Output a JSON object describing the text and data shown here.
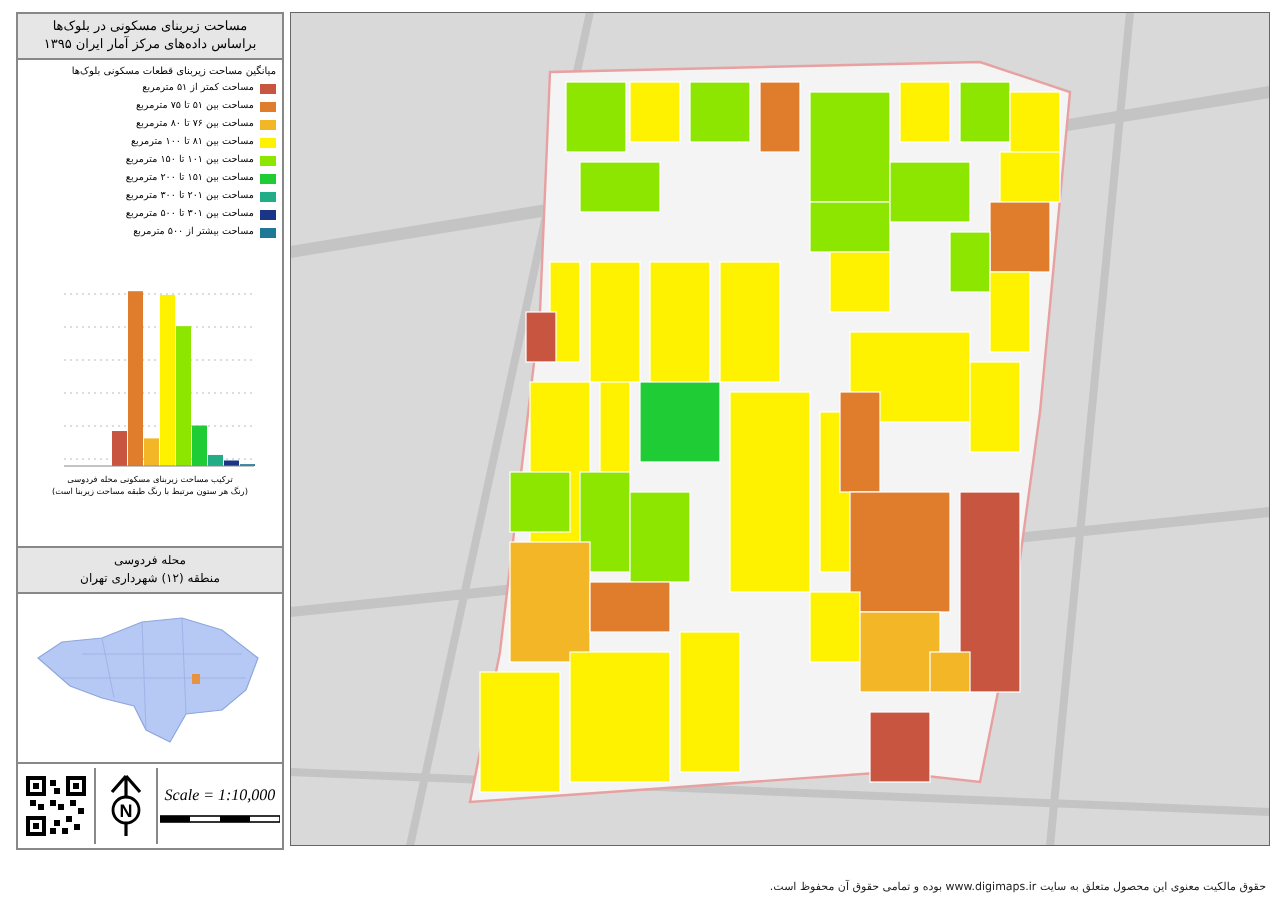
{
  "panel": {
    "title": "مساحت زیربنای مسکونی در بلوک‌ها",
    "subtitle": "براساس داده‌های مرکز آمار ایران ۱۳۹۵",
    "legend_heading": "میانگین مساحت زیربنای قطعات مسکونی بلوک‌ها",
    "legend": [
      {
        "label": "مساحت کمتر از ۵۱ مترمربع",
        "color": "#c8553f"
      },
      {
        "label": "مساحت بین ۵۱ تا ۷۵ مترمربع",
        "color": "#e07d2c"
      },
      {
        "label": "مساحت بین ۷۶ تا ۸۰ مترمربع",
        "color": "#f2b626"
      },
      {
        "label": "مساحت بین ۸۱ تا ۱۰۰ مترمربع",
        "color": "#fff200"
      },
      {
        "label": "مساحت بین ۱۰۱ تا ۱۵۰ مترمربع",
        "color": "#8de600"
      },
      {
        "label": "مساحت بین ۱۵۱ تا ۲۰۰ مترمربع",
        "color": "#1fcc35"
      },
      {
        "label": "مساحت بین ۲۰۱ تا ۳۰۰ مترمربع",
        "color": "#22ad86"
      },
      {
        "label": "مساحت بین ۳۰۱ تا ۵۰۰ مترمربع",
        "color": "#1a3585"
      },
      {
        "label": "مساحت بیشتر از ۵۰۰ مترمربع",
        "color": "#1f7895"
      }
    ],
    "chart_caption": "ترکیب مساحت زیربنای مسکونی محله فردوسی",
    "chart_note": "(رنگ هر ستون مرتبط با رنگ طبقه مساحت زیربنا است)",
    "area_name": "محله فردوسی",
    "district": "منطقه (۱۲) شهرداری تهران",
    "scale": "Scale = 1:10,000",
    "north": "N"
  },
  "footer": "حقوق مالکیت معنوی این محصول متعلق به سایت www.digimaps.ir بوده و تمامی حقوق آن محفوظ است."
}
